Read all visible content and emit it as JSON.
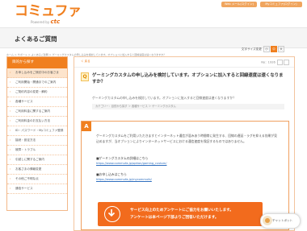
{
  "brand": {
    "logo": "コミュファ",
    "powered_by": "Powered by",
    "powered_by_brand": "ctc"
  },
  "header_links": [
    "Web メール(ログイン)",
    "Myコミュファ(ログイン)"
  ],
  "page_title": "よくあるご質問",
  "breadcrumb": "ホーム ＞ サポート ＞ よくあるご質問 ＞ ゲーミングカスタムの申し込みを検討しています。オプションに加入すると回線速度は速くなりますか？",
  "text_size": {
    "label": "文字サイズ変更",
    "options": [
      "小",
      "中",
      "大"
    ],
    "selected": 1
  },
  "sidebar": {
    "title": "目的から探す",
    "items": [
      "お申し込みをご検討中のお客さま",
      "ご利用開始・開通までのご案内",
      "ご契約内容の変更・解約",
      "各種サービス",
      "ご利用料金に関するご案内",
      "ご利用料金のお支払い方法",
      "ID・パスワード・Myコミュファ登録",
      "接続・設定方法",
      "故障・トラブル",
      "引越しに関するご案内",
      "お客さまの情報変更",
      "その他ご不明な点",
      "通信サービス"
    ]
  },
  "main": {
    "back_label": "＜ 戻る",
    "question_no": "No：1926",
    "q_badge": "Q",
    "question_title": "ゲーミングカスタムの申し込みを検討しています。オプションに加入すると回線速度は速くなりますか？",
    "question_body": "ゲーミングカスタムの申し込みを検討しています。オプションに加入すると回線速度は速くなりますか？",
    "category": "カテゴリー：目的から探す ＞ 各種サービス ＞ ゲーミングカスタム",
    "a_badge": "A",
    "answer_body": "ゲーミングカスタムをご利用いただきますとインターネット通信が混みあう時間帯に発生する、回線の遅延・ラグを抑える効果が見込めますが、当オプションによりインターネットサービスにおける通信速度を保証するものではありません。",
    "links": [
      {
        "label": "■ゲーミングカスタムの詳細はこちら",
        "url": "https://www.commufa.jp/option/gaming_custom/"
      },
      {
        "label": "■お申し込みはこちら",
        "url": "https://www.commufa.jp/mycommufa/"
      }
    ],
    "survey_line1": "サービス向上のためアンケートにご協力をお願いいたします。",
    "survey_line2": "アンケートは本ページ下部よりご回答いただけます。"
  },
  "chatbot_label": "チャットボット",
  "colors": {
    "accent": "#f07f1e",
    "survey_bg": "#f26b1d",
    "link": "#2f6fbf"
  }
}
